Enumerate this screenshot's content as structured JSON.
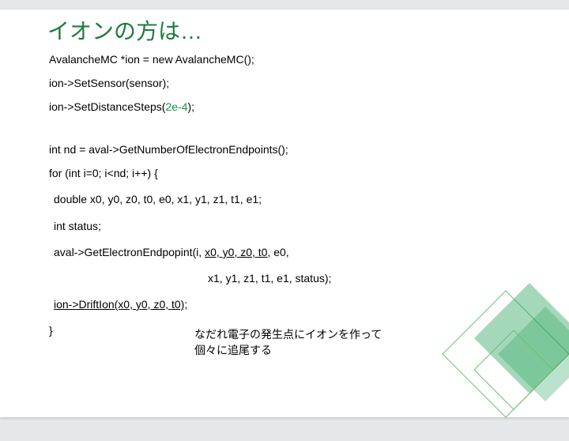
{
  "title": "イオンの方は…",
  "lines": {
    "l1": "AvalancheMC *ion = new AvalancheMC();",
    "l2": "ion->SetSensor(sensor);",
    "l3_pre": "ion->SetDistanceSteps(",
    "l3_green": "2e-4",
    "l3_post": ");",
    "l4": "int nd = aval->GetNumberOfElectronEndpoints();",
    "l5": "for (int i=0; i<nd; i++) {",
    "l6": "double x0, y0, z0, t0, e0, x1, y1, z1, t1, e1;",
    "l7": "int status;",
    "l8_pre": "aval->GetElectronEndpopint(i, ",
    "l8_ul": "x0, y0, z0, t0,",
    "l8_post": " e0,",
    "l8b": "x1, y1, z1, t1, e1, status);",
    "l9": "ion->DriftIon(x0, y0, z0, t0);",
    "l10": "}"
  },
  "note1": "なだれ電子の発生点にイオンを作って",
  "note2": "個々に追尾する"
}
